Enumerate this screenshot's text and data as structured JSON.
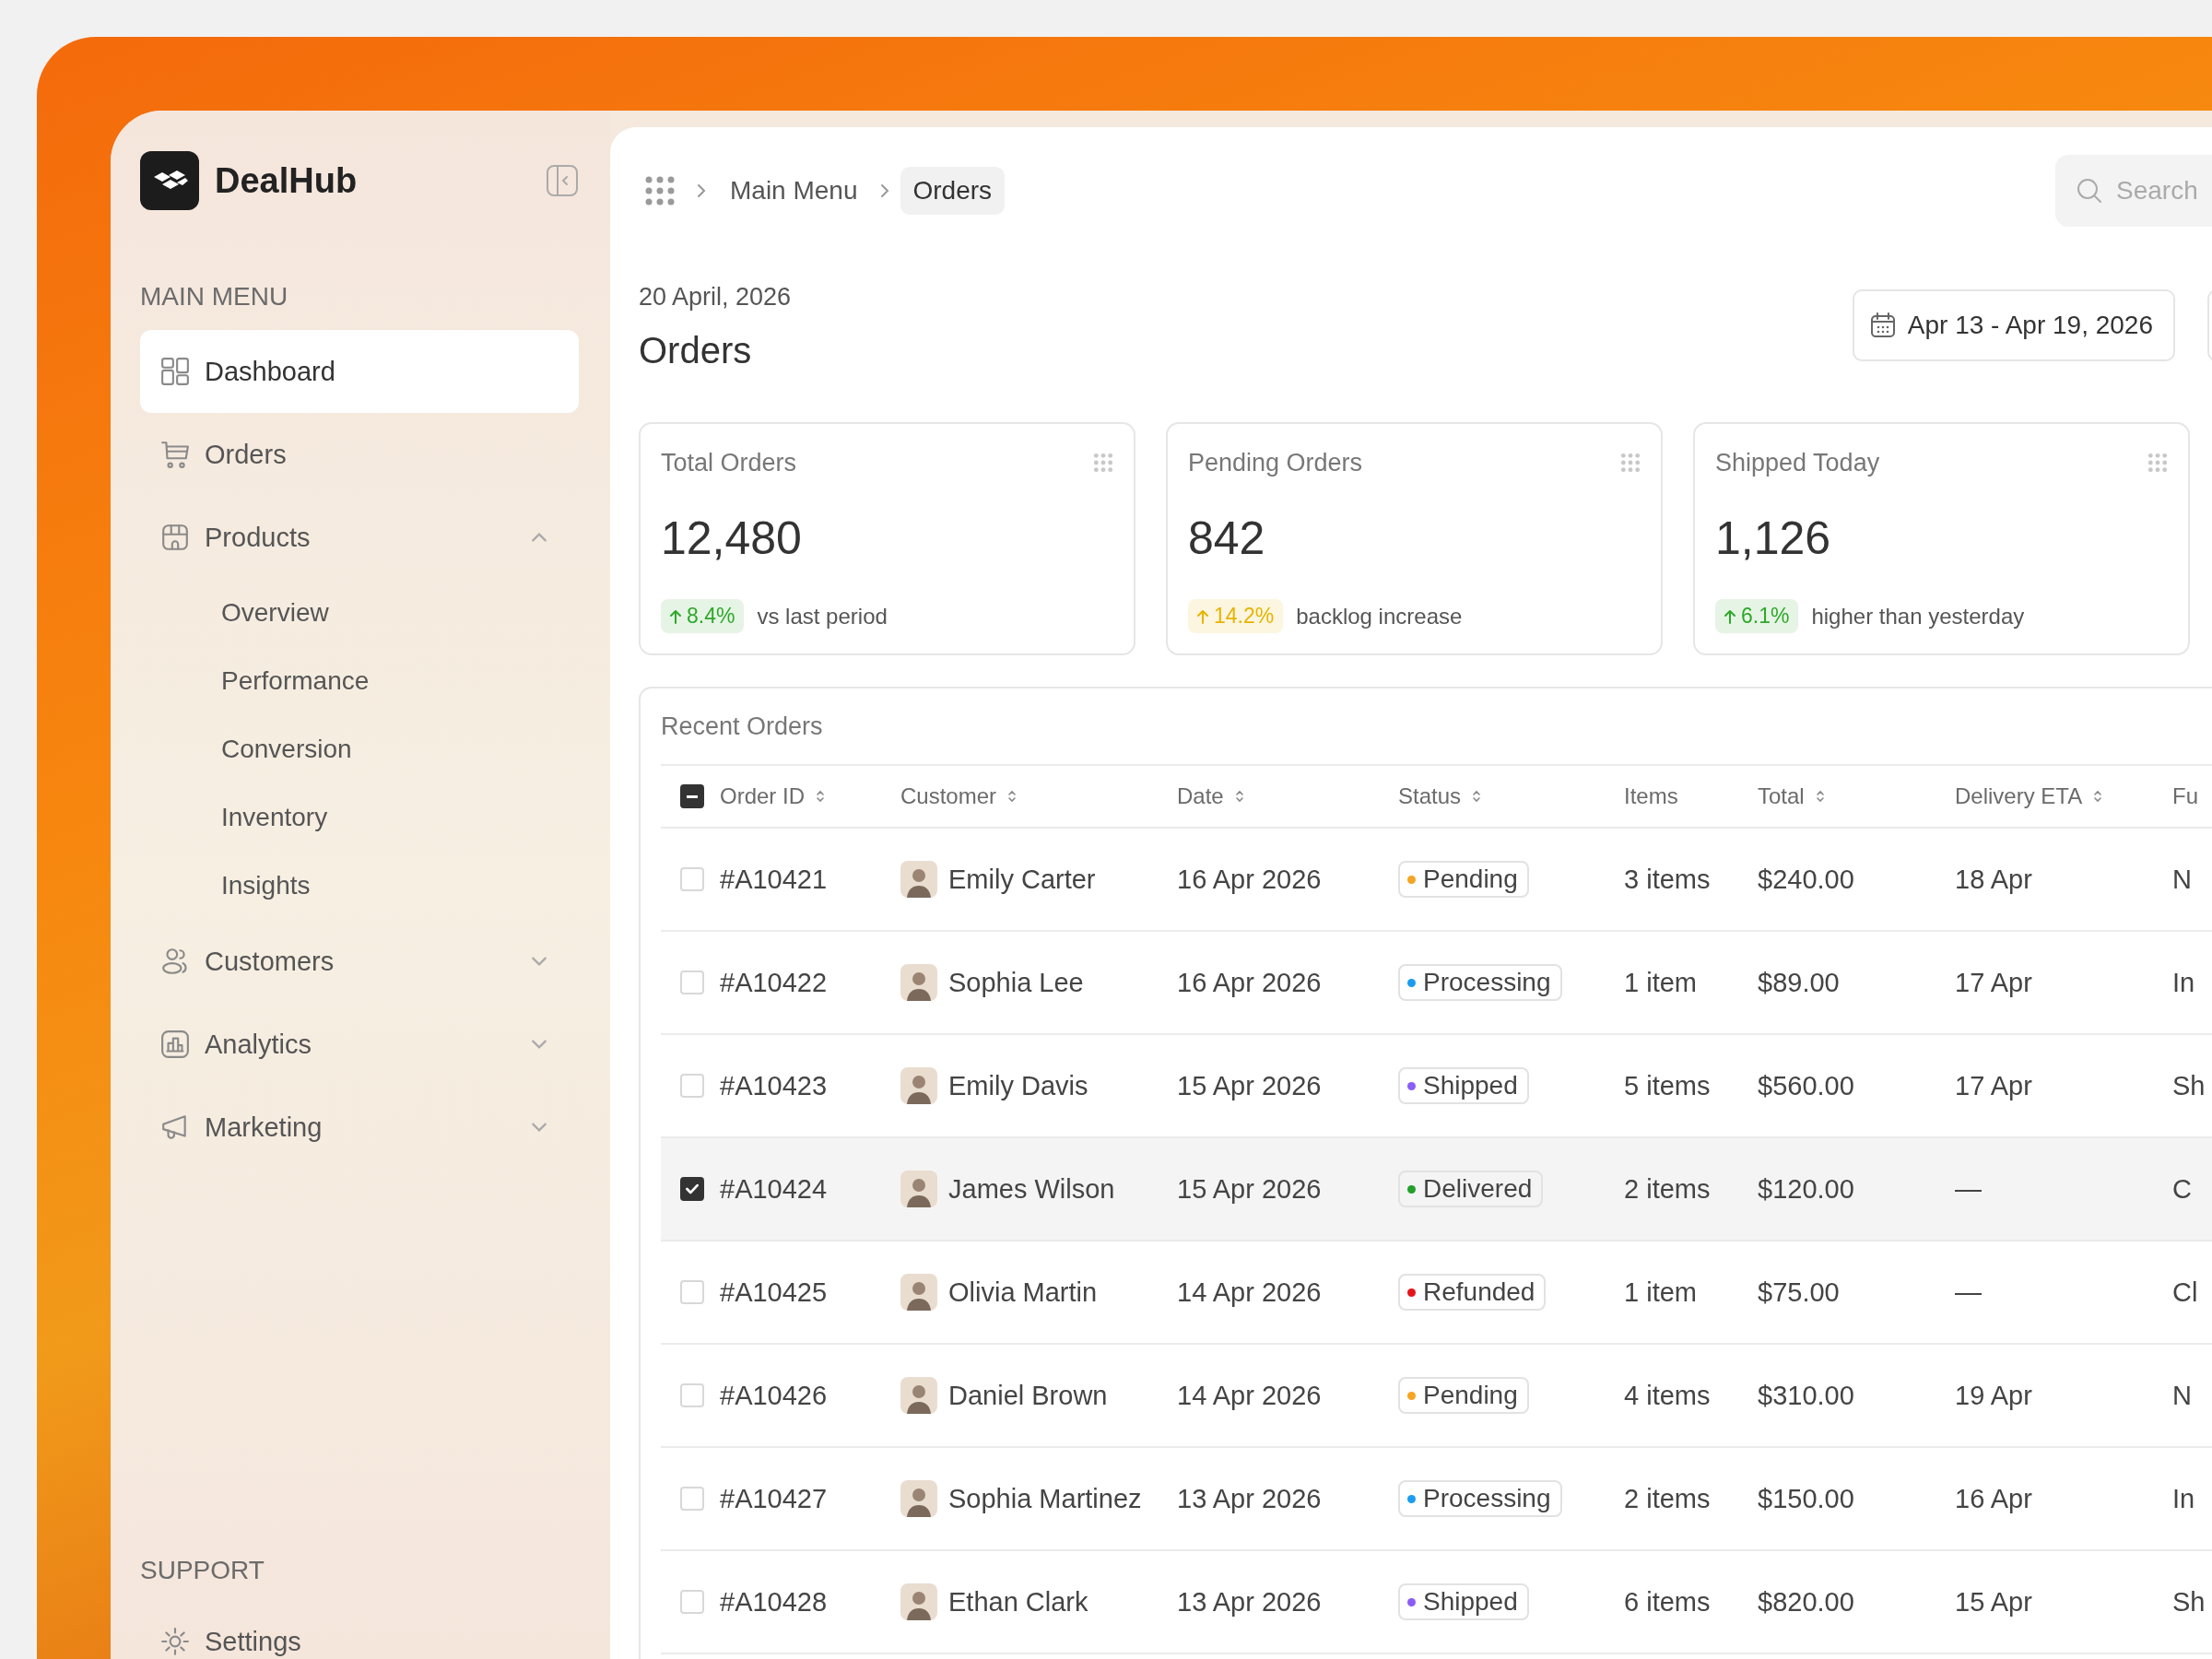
{
  "sidebar": {
    "brand": "DealHub",
    "sections": [
      {
        "title": "MAIN MENU",
        "items": [
          {
            "label": "Dashboard",
            "selected": true
          },
          {
            "label": "Orders",
            "selected": false
          },
          {
            "label": "Products",
            "selected": false,
            "expanded": true,
            "children": [
              {
                "label": "Overview",
                "selected": false
              },
              {
                "label": "Performance",
                "selected": false
              },
              {
                "label": "Conversion",
                "selected": false
              },
              {
                "label": "Inventory",
                "selected": false
              },
              {
                "label": "Insights",
                "selected": false
              }
            ]
          },
          {
            "label": "Customers",
            "selected": false,
            "expanded": false
          },
          {
            "label": "Analytics",
            "selected": false,
            "expanded": false
          },
          {
            "label": "Marketing",
            "selected": false,
            "expanded": false
          }
        ]
      },
      {
        "title": "SUPPORT",
        "items": [
          {
            "label": "Settings",
            "selected": false
          }
        ]
      }
    ]
  },
  "breadcrumb": [
    {
      "label": "Main Menu",
      "selected": false
    },
    {
      "label": "Orders",
      "selected": true
    }
  ],
  "search": {
    "placeholder": "Search"
  },
  "header": {
    "date": "20 April, 2026",
    "title": "Orders",
    "range": "Apr 13 - Apr 19, 2026"
  },
  "stats": [
    {
      "title": "Total Orders",
      "value": "12,480",
      "delta": "8.4%",
      "color": "#2ea82a",
      "note": "vs last period"
    },
    {
      "title": "Pending Orders",
      "value": "842",
      "delta": "14.2%",
      "color": "#e8b300",
      "note": "backlog increase"
    },
    {
      "title": "Shipped Today",
      "value": "1,126",
      "delta": "6.1%",
      "color": "#2ea82a",
      "note": "higher than yesterday"
    }
  ],
  "table": {
    "title": "Recent Orders",
    "select_all_partial": true,
    "columns": [
      {
        "label": "Order ID",
        "sortable": true
      },
      {
        "label": "Customer",
        "sortable": true
      },
      {
        "label": "Date",
        "sortable": true
      },
      {
        "label": "Status",
        "sortable": true
      },
      {
        "label": "Items",
        "sortable": false
      },
      {
        "label": "Total",
        "sortable": true
      },
      {
        "label": "Delivery ETA",
        "sortable": true
      },
      {
        "label": "Fu",
        "sortable": false
      }
    ],
    "rows": [
      {
        "selected": false,
        "id": "#A10421",
        "customer": "Emily Carter",
        "date": "16 Apr 2026",
        "status": "Pending",
        "color": "#f5a524",
        "items": "3 items",
        "total": "$240.00",
        "eta": "18 Apr",
        "column_8": "N"
      },
      {
        "selected": false,
        "id": "#A10422",
        "customer": "Sophia Lee",
        "date": "16 Apr 2026",
        "status": "Processing",
        "color": "#1c9cf0",
        "items": "1 item",
        "total": "$89.00",
        "eta": "17 Apr",
        "column_8": "In"
      },
      {
        "selected": false,
        "id": "#A10423",
        "customer": "Emily Davis",
        "date": "15 Apr 2026",
        "status": "Shipped",
        "color": "#8b5cf6",
        "items": "5 items",
        "total": "$560.00",
        "eta": "17 Apr",
        "column_8": "Sh"
      },
      {
        "selected": true,
        "id": "#A10424",
        "customer": "James Wilson",
        "date": "15 Apr 2026",
        "status": "Delivered",
        "color": "#22a02a",
        "items": "2 items",
        "total": "$120.00",
        "eta": "—",
        "column_8": "C"
      },
      {
        "selected": false,
        "id": "#A10425",
        "customer": "Olivia Martin",
        "date": "14 Apr 2026",
        "status": "Refunded",
        "color": "#e5141b",
        "items": "1 item",
        "total": "$75.00",
        "eta": "—",
        "column_8": "Cl"
      },
      {
        "selected": false,
        "id": "#A10426",
        "customer": "Daniel Brown",
        "date": "14 Apr 2026",
        "status": "Pending",
        "color": "#f5a524",
        "items": "4 items",
        "total": "$310.00",
        "eta": "19 Apr",
        "column_8": "N"
      },
      {
        "selected": false,
        "id": "#A10427",
        "customer": "Sophia Martinez",
        "date": "13 Apr 2026",
        "status": "Processing",
        "color": "#1c9cf0",
        "items": "2 items",
        "total": "$150.00",
        "eta": "16 Apr",
        "column_8": "In"
      },
      {
        "selected": false,
        "id": "#A10428",
        "customer": "Ethan Clark",
        "date": "13 Apr 2026",
        "status": "Shipped",
        "color": "#8b5cf6",
        "items": "6 items",
        "total": "$820.00",
        "eta": "15 Apr",
        "column_8": "Sh"
      }
    ]
  }
}
